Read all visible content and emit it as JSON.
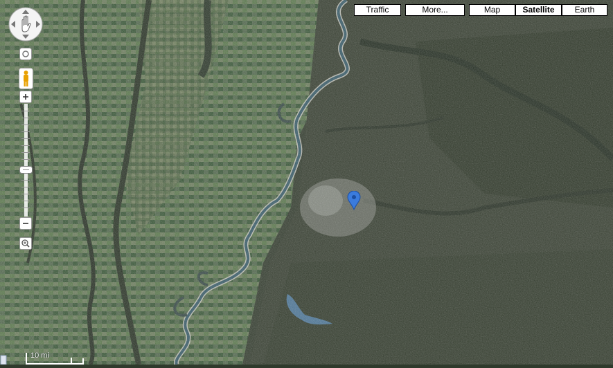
{
  "map_types": {
    "traffic_label": "Traffic",
    "more_label": "More...",
    "map_label": "Map",
    "satellite_label": "Satellite",
    "earth_label": "Earth",
    "active": "Satellite"
  },
  "scale": {
    "label": "10 mi"
  },
  "marker": {
    "color": "#3b7bdc"
  },
  "colors": {
    "river": "#3a5d6a",
    "river_sand": "#c8c8bf",
    "lake": "#4f7898",
    "city": "#8f948d",
    "farmland_green": "#3f6a3a",
    "forest_dark": "#2d3528"
  }
}
